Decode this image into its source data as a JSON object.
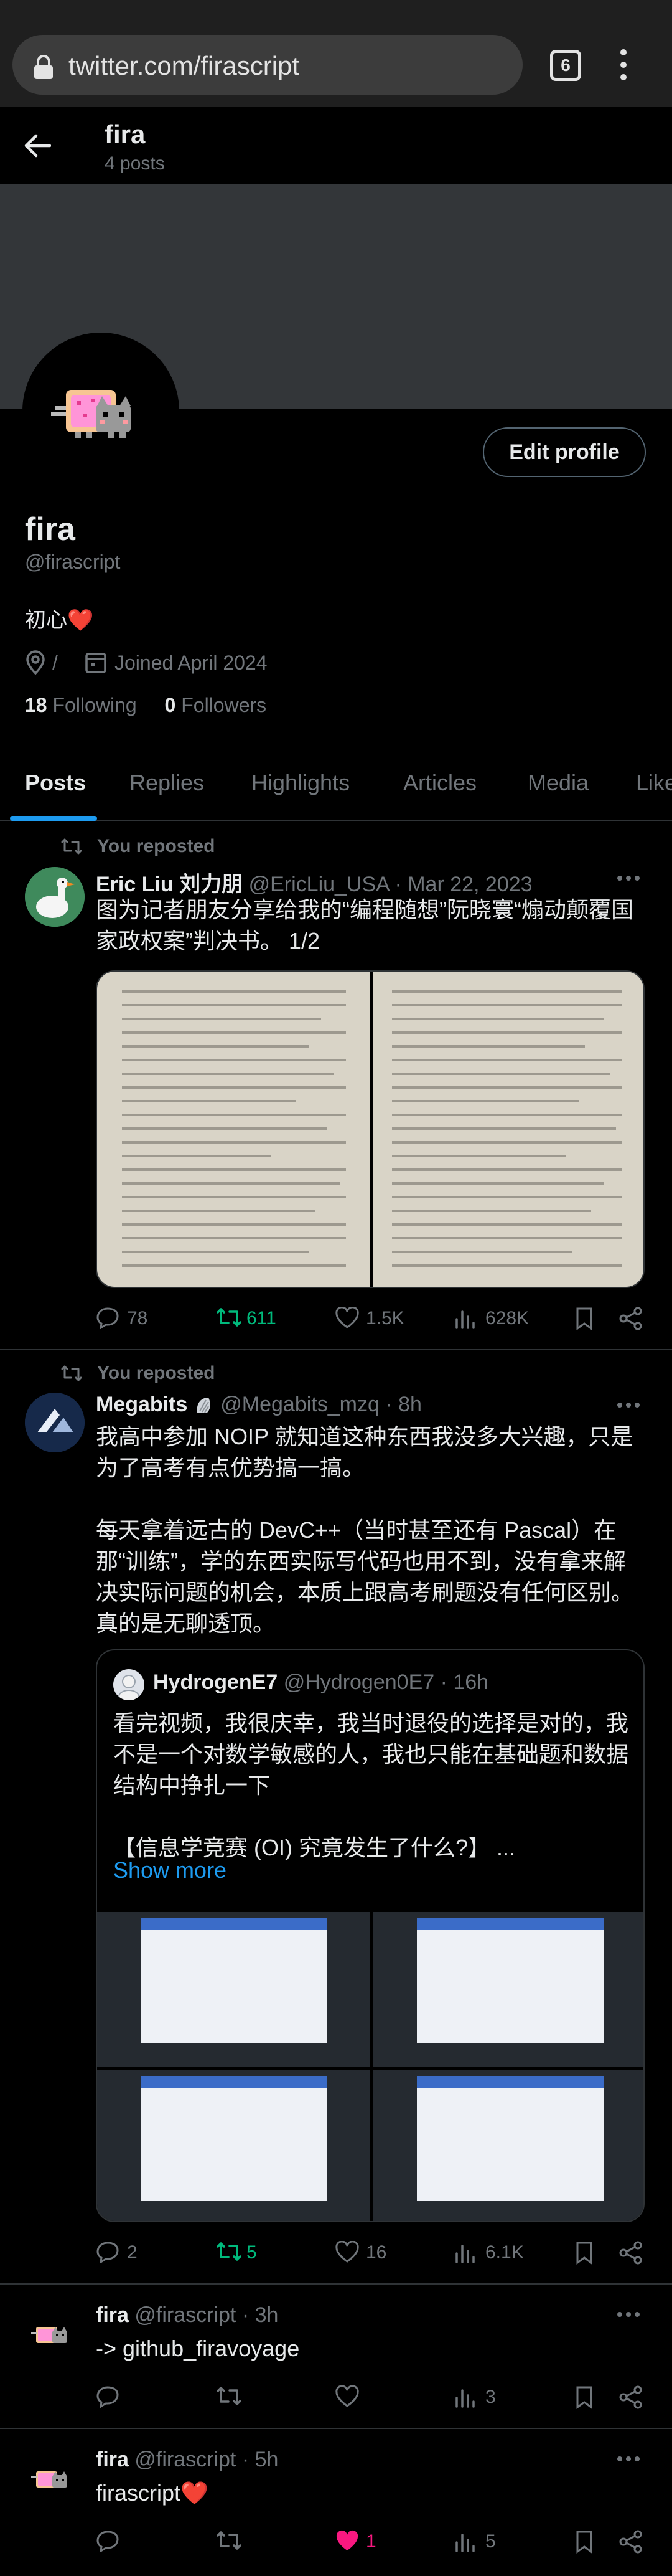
{
  "browser": {
    "url": "twitter.com/firascript",
    "tab_count": "6"
  },
  "profile": {
    "nav_name": "fira",
    "nav_posts": "4 posts",
    "name": "fira",
    "handle": "@firascript",
    "bio": "初心❤️",
    "link_text": "/",
    "joined": "Joined April 2024",
    "following_count": "18",
    "following_label": "Following",
    "followers_count": "0",
    "followers_label": "Followers",
    "edit_button": "Edit profile"
  },
  "tabs": [
    "Posts",
    "Replies",
    "Highlights",
    "Articles",
    "Media",
    "Likes"
  ],
  "tweets": [
    {
      "repost_label": "You reposted",
      "author": "Eric Liu 刘力朋",
      "handle": "@EricLiu_USA",
      "time": "Mar 22, 2023",
      "text": "图为记者朋友分享给我的“编程随想”阮晓寰“煽动颠覆国家政权案”判决书。 1/2",
      "replies": "78",
      "reposts": "611",
      "likes": "1.5K",
      "views": "628K"
    },
    {
      "repost_label": "You reposted",
      "author": "Megabits",
      "handle": "@Megabits_mzq",
      "time": "8h",
      "text": "我高中参加 NOIP 就知道这种东西我没多大兴趣，只是为了高考有点优势搞一搞。\n\n每天拿着远古的 DevC++（当时甚至还有 Pascal）在那“训练”，学的东西实际写代码也用不到，没有拿来解决实际问题的机会，本质上跟高考刷题没有任何区别。真的是无聊透顶。",
      "quote": {
        "author": "HydrogenE7",
        "handle": "@Hydrogen0E7",
        "time": "16h",
        "text": "看完视频，我很庆幸，我当时退役的选择是对的，我不是一个对数学敏感的人，我也只能在基础题和数据结构中挣扎一下\n\n【信息学竞赛 (OI) 究竟发生了什么?】 ...",
        "show_more": "Show more"
      },
      "replies": "2",
      "reposts": "5",
      "likes": "16",
      "views": "6.1K"
    },
    {
      "author": "fira",
      "handle": "@firascript",
      "time": "3h",
      "text": "-> github_firavoyage",
      "views": "3"
    },
    {
      "author": "fira",
      "handle": "@firascript",
      "time": "5h",
      "text": "firascript❤️",
      "likes": "1",
      "views": "5"
    }
  ],
  "colors": {
    "accent": "#1d9bf0",
    "repost_green": "#00ba7c",
    "like_pink": "#f91880",
    "muted": "#71767b"
  }
}
